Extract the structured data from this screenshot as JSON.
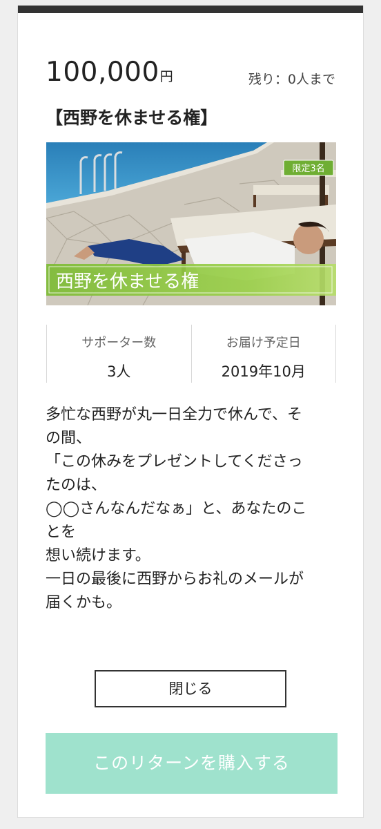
{
  "reward": {
    "price_value": "100,000",
    "price_unit": "円",
    "remaining": "残り：0人まで",
    "title": "【西野を休ませる権】",
    "image": {
      "badge": "限定3名",
      "caption": "西野を休ませる権"
    },
    "stats": [
      {
        "label": "サポーター数",
        "value": "3人"
      },
      {
        "label": "お届け予定日",
        "value": "2019年10月"
      }
    ],
    "description_lines": [
      "多忙な西野が丸一日全力で休んで、そ",
      "の間、",
      "「この休みをプレゼントしてくださっ",
      "たのは、",
      "◯◯さんなんだなぁ」と、あなたのこ",
      "とを",
      "想い続けます。",
      "一日の最後に西野からお礼のメールが",
      "届くかも。"
    ]
  },
  "actions": {
    "close_label": "閉じる",
    "buy_label": "このリターンを購入する"
  },
  "colors": {
    "buy_button": "#9fe2cd",
    "top_bar": "#333333",
    "caption_band": "#8cc63f"
  }
}
